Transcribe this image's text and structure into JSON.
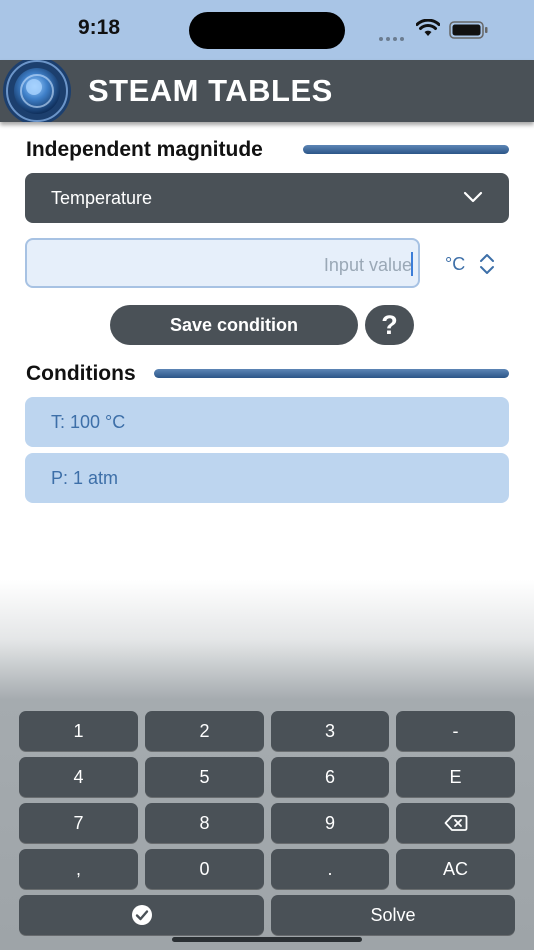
{
  "status_bar": {
    "time": "9:18"
  },
  "app_bar": {
    "title": "STEAM TABLES"
  },
  "independent": {
    "heading": "Independent magnitude",
    "selected": "Temperature",
    "input_placeholder": "Input value",
    "unit": "°C"
  },
  "buttons": {
    "save": "Save condition",
    "help": "?"
  },
  "conditions": {
    "heading": "Conditions",
    "items": [
      "T: 100 °C",
      "P: 1 atm"
    ]
  },
  "keyboard": {
    "rows": [
      [
        "1",
        "2",
        "3",
        "-"
      ],
      [
        "4",
        "5",
        "6",
        "E"
      ],
      [
        "7",
        "8",
        "9",
        "backspace-icon"
      ],
      [
        ",",
        "0",
        ".",
        "AC"
      ]
    ],
    "confirm_icon": "checkmark-circle-icon",
    "solve": "Solve"
  },
  "colors": {
    "status_bar": "#a9c5e6",
    "dark_surface": "#4a5157",
    "accent_bar": "#2c5688",
    "condition_chip": "#bdd5ef",
    "input_fill": "#e6effa",
    "accent_text": "#3d6fa8"
  }
}
